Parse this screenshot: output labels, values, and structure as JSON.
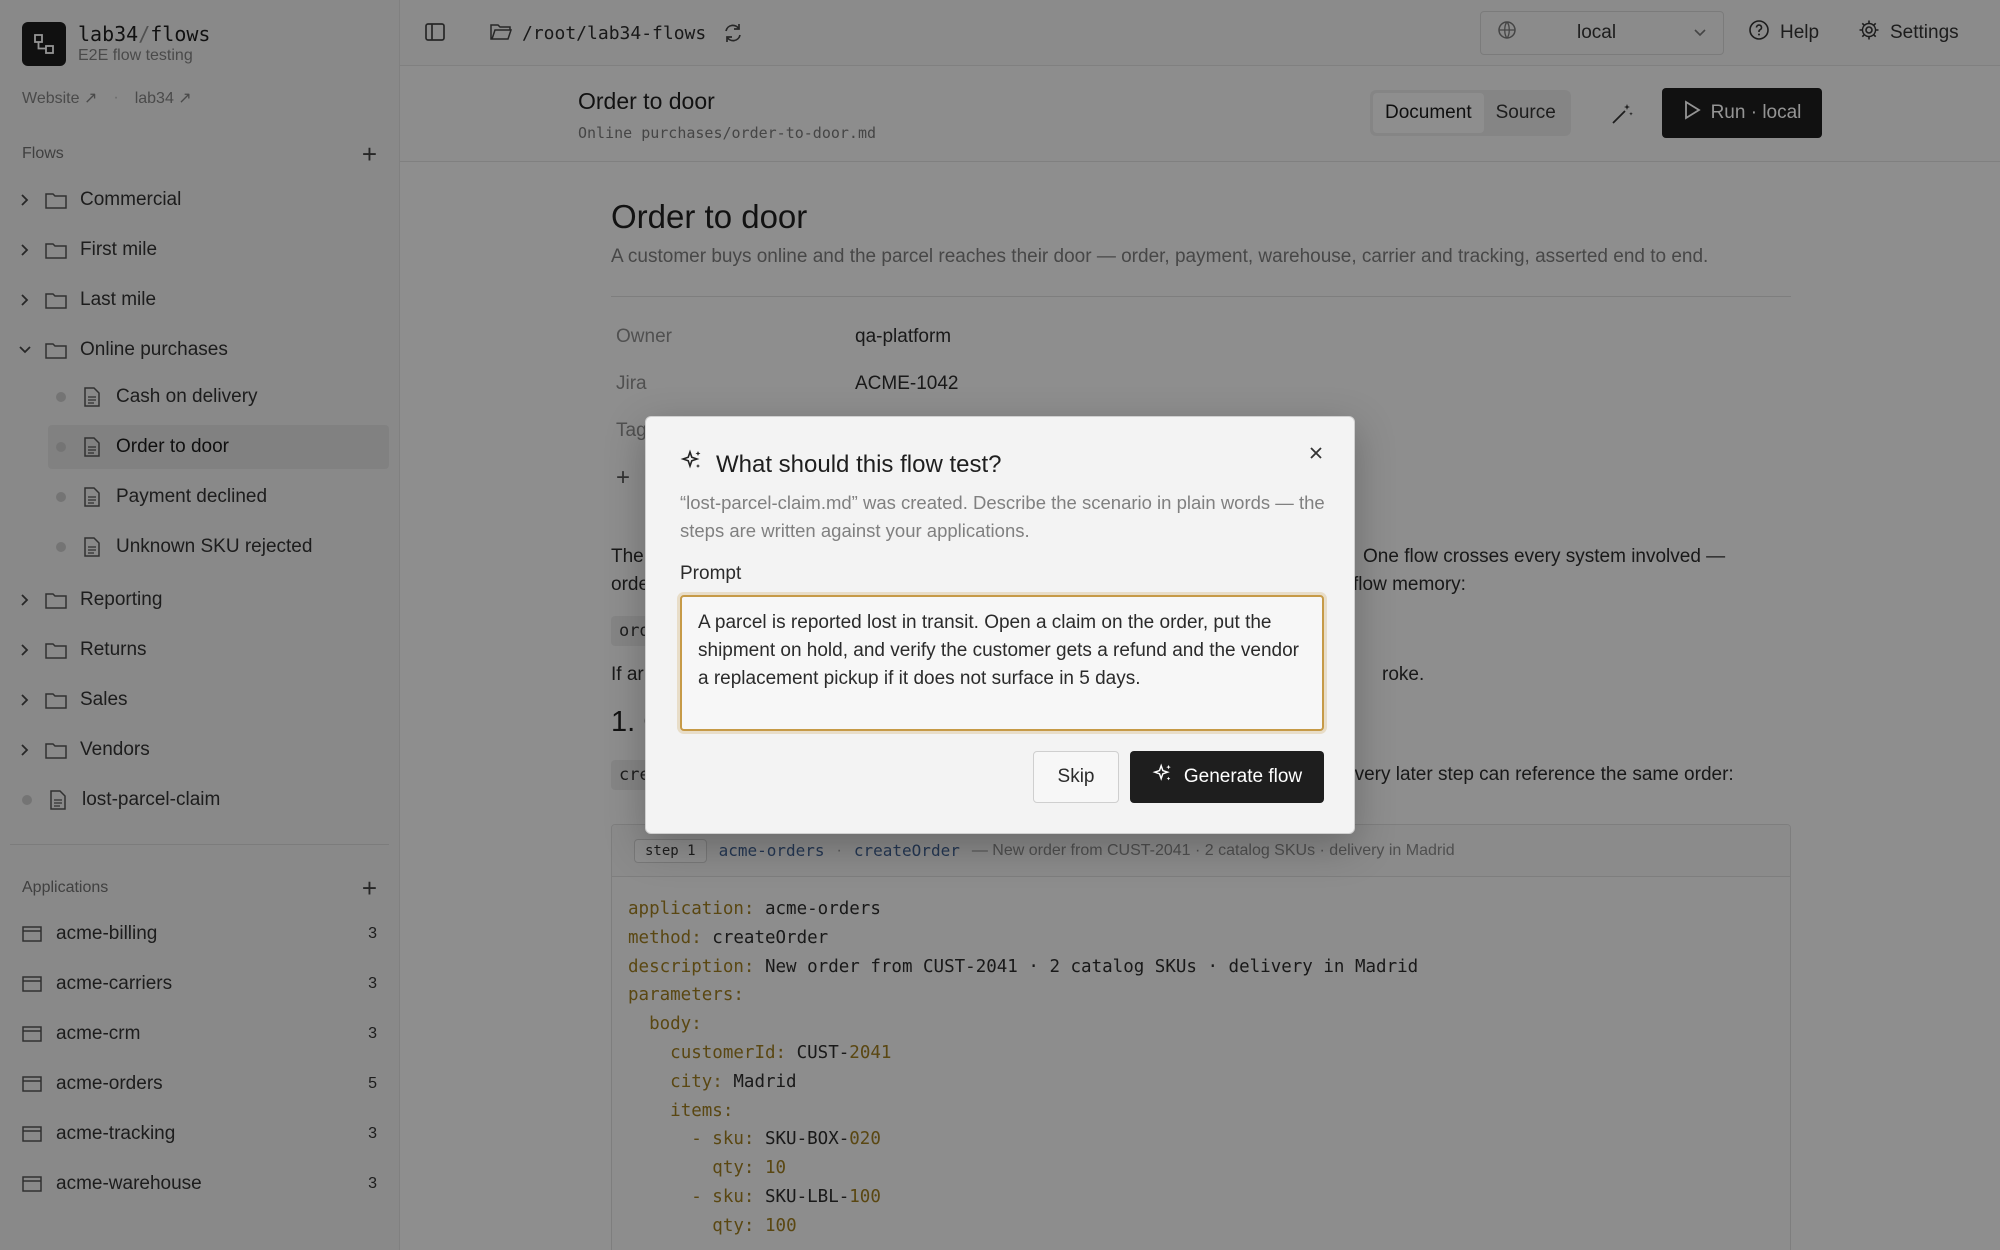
{
  "brand": {
    "name_left": "lab34",
    "name_sep": "/",
    "name_right": "flows",
    "subtitle": "E2E flow testing"
  },
  "links": {
    "website": "Website ↗",
    "sep": "·",
    "lab34": "lab34 ↗"
  },
  "flows_section": {
    "label": "Flows",
    "folders": [
      {
        "label": "Commercial"
      },
      {
        "label": "First mile"
      },
      {
        "label": "Last mile"
      },
      {
        "label": "Online purchases"
      }
    ],
    "online_purchases_files": [
      {
        "label": "Cash on delivery"
      },
      {
        "label": "Order to door"
      },
      {
        "label": "Payment declined"
      },
      {
        "label": "Unknown SKU rejected"
      }
    ],
    "folders_after": [
      {
        "label": "Reporting"
      },
      {
        "label": "Returns"
      },
      {
        "label": "Sales"
      },
      {
        "label": "Vendors"
      }
    ],
    "root_file": "lost-parcel-claim"
  },
  "applications": {
    "label": "Applications",
    "items": [
      {
        "label": "acme-billing",
        "count": "3"
      },
      {
        "label": "acme-carriers",
        "count": "3"
      },
      {
        "label": "acme-crm",
        "count": "3"
      },
      {
        "label": "acme-orders",
        "count": "5"
      },
      {
        "label": "acme-tracking",
        "count": "3"
      },
      {
        "label": "acme-warehouse",
        "count": "3"
      }
    ]
  },
  "topbar": {
    "path": "/root/lab34-flows",
    "env": "local",
    "help": "Help",
    "settings": "Settings"
  },
  "docheader": {
    "title": "Order to door",
    "path": "Online purchases/order-to-door.md",
    "tab_document": "Document",
    "tab_source": "Source",
    "run_label": "Run · local"
  },
  "doc": {
    "title": "Order to door",
    "lead": "A customer buys online and the parcel reaches their door — order, payment, warehouse, carrier and tracking, asserted end to end.",
    "owner_label": "Owner",
    "owner_value": "qa-platform",
    "jira_label": "Jira",
    "jira_value": "ACME-1042",
    "tags_label": "Tag",
    "add_tag": "+",
    "para1_left": "The",
    "para1_right": "One flow crosses every system involved —",
    "para2_left": "orde",
    "para2_right": "flow memory:",
    "chip1": "ord",
    "para3_left": "If ar",
    "para3_right": "roke.",
    "h2": "1. C",
    "chip2": "cre",
    "para4_right": "every later step can reference the same order:",
    "step": {
      "badge": "step 1",
      "app": "acme-orders",
      "dot": "·",
      "method": "createOrder",
      "desc": "— New order from CUST-2041 · 2 catalog SKUs · delivery in Madrid"
    }
  },
  "modal": {
    "title": "What should this flow test?",
    "description": "“lost-parcel-claim.md” was created. Describe the scenario in plain words — the steps are written against your applications.",
    "prompt_label": "Prompt",
    "prompt_value": "A parcel is reported lost in transit. Open a claim on the order, put the shipment on hold, and verify the customer gets a refund and the vendor a replacement pickup if it does not surface in 5 days.",
    "skip": "Skip",
    "generate": "Generate flow"
  }
}
